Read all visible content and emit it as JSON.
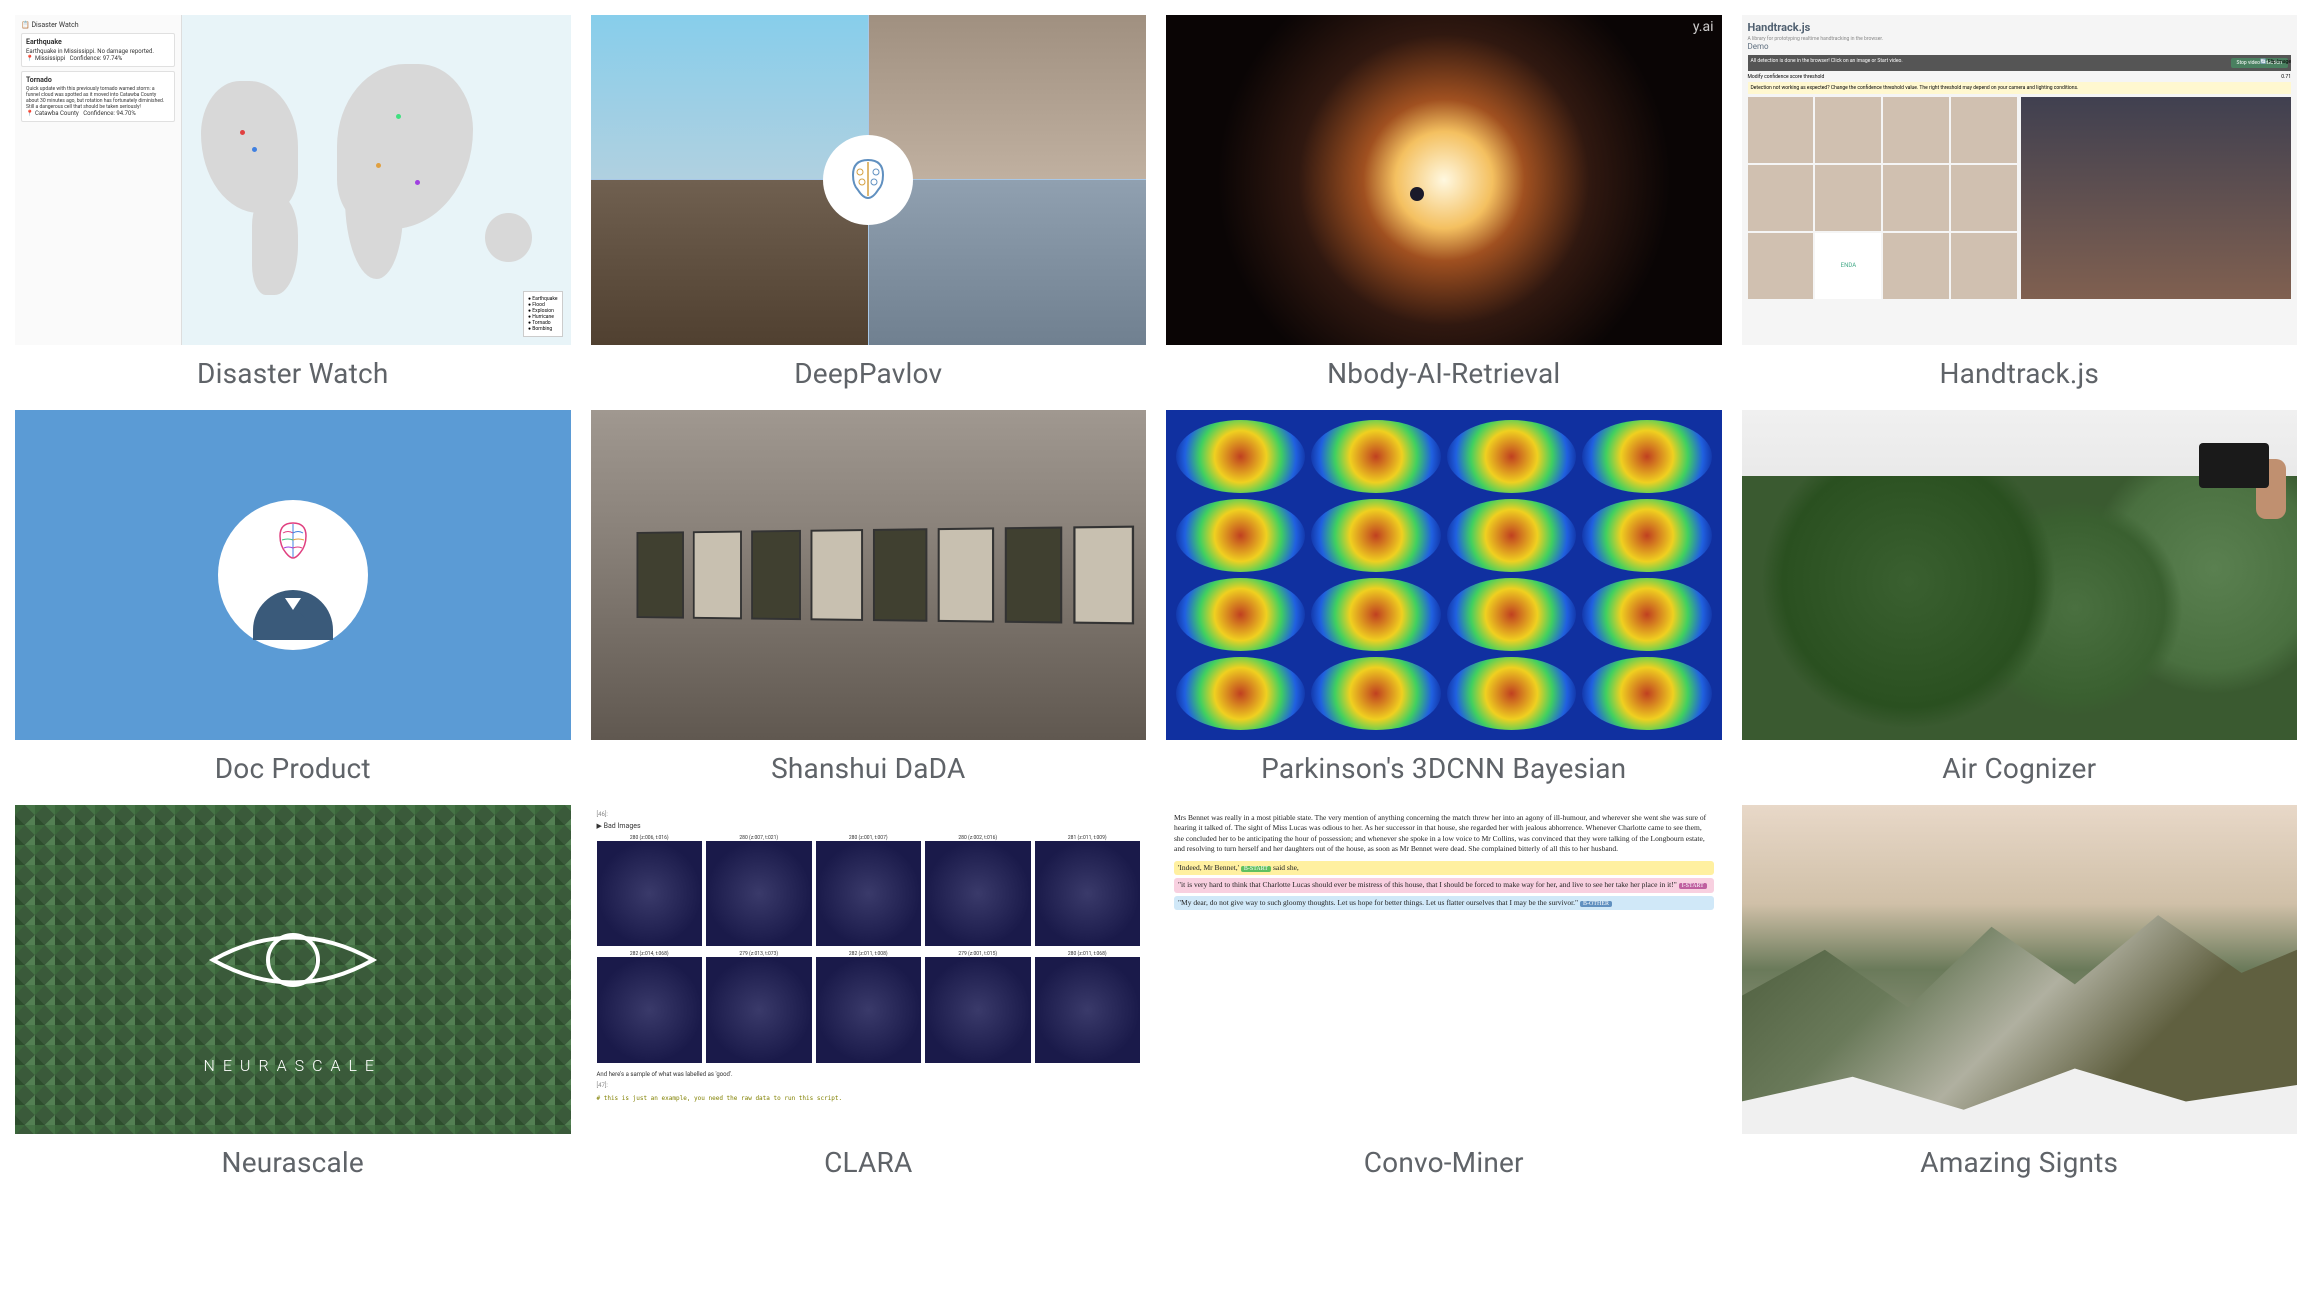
{
  "cards": [
    {
      "title": "Disaster Watch",
      "thumb": {
        "app_title": "Disaster Watch",
        "events": [
          {
            "title": "Earthquake",
            "subtitle": "Earthquake in Mississippi. No damage reported.",
            "location": "Mississippi",
            "confidence": "97.74%"
          },
          {
            "title": "Tornado",
            "subtitle": "Quick update with this previously tornado warned storm: a funnel cloud was spotted as it moved into Catawba County about 30 minutes ago, but rotation has fortunately diminished. Still a dangerous cell that should be taken seriously!",
            "location": "Catawba County",
            "confidence": "94.70%"
          }
        ],
        "legend": [
          "Earthquake",
          "Flood",
          "Explosion",
          "Hurricane",
          "Tornado",
          "Bombing"
        ]
      }
    },
    {
      "title": "DeepPavlov",
      "thumb": {}
    },
    {
      "title": "Nbody-AI-Retrieval",
      "thumb": {
        "watermark": "y.ai"
      }
    },
    {
      "title": "Handtrack.js",
      "thumb": {
        "header": "Handtrack.js",
        "tagline": "A library for prototyping realtime handtracking in the browser.",
        "demo_label": "Demo",
        "bar_text": "All detection is done in the browser! Click on an image or Start video.",
        "button": "Stop video detection",
        "slider_label": "Modify confidence score threshold",
        "slider_value": "0.71",
        "notice": "Detection not working as expected? Change the confidence threshold value. The right threshold may depend on your camera and lighting conditions.",
        "flip_label": "Flip Image",
        "enda_label": "ENDA"
      }
    },
    {
      "title": "Doc Product",
      "thumb": {}
    },
    {
      "title": "Shanshui DaDA",
      "thumb": {}
    },
    {
      "title": "Parkinson's 3DCNN Bayesian",
      "thumb": {}
    },
    {
      "title": "Air Cognizer",
      "thumb": {}
    },
    {
      "title": "Neurascale",
      "thumb": {
        "logo_text": "NEURASCALE"
      }
    },
    {
      "title": "CLARA",
      "thumb": {
        "cell_out": "[46]:",
        "section_label": "Bad Images",
        "row1": [
          "280 (z:006, t:016)",
          "280 (z:007, t:021)",
          "280 (z:001, t:007)",
          "280 (z:002, t:016)",
          "281 (z:011, t:009)"
        ],
        "row2": [
          "282 (z:014, t:068)",
          "279 (z:013, t:073)",
          "282 (z:011, t:008)",
          "279 (z:001, t:015)",
          "280 (z:011, t:068)"
        ],
        "good_label": "And here's a sample of what was labelled as 'good'.",
        "cell_in": "[47]:",
        "code": "# this is just an example, you need the raw data to run this script."
      }
    },
    {
      "title": "Convo-Miner",
      "thumb": {
        "paragraph": "Mrs Bennet was really in a most pitiable state. The very mention of anything concerning the match threw her into an agony of ill-humour, and wherever she went she was sure of hearing it talked of. The sight of Miss Lucas was odious to her. As her successor in that house, she regarded her with jealous abhorrence. Whenever Charlotte came to see them, she concluded her to be anticipating the hour of possession; and whenever she spoke in a low voice to Mr Collins, was convinced that they were talking of the Longbourn estate, and resolving to turn herself and her daughters out of the house, as soon as Mr Bennet were dead. She complained bitterly of all this to her husband.",
        "line1_quote": "'Indeed, Mr Bennet,'",
        "line1_tag": "B-START",
        "line1_rest": "said she,",
        "line2": "\"it is very hard to think that Charlotte Lucas should ever be mistress of this house, that I should be forced to make way for her, and live to see her take her place in it!\"",
        "line2_tag": "I-START",
        "line3": "\"My dear, do not give way to such gloomy thoughts. Let us hope for better things. Let us flatter ourselves that I may be the survivor.\"",
        "line3_tag": "B-OTHER"
      }
    },
    {
      "title": "Amazing Signts",
      "thumb": {}
    }
  ]
}
